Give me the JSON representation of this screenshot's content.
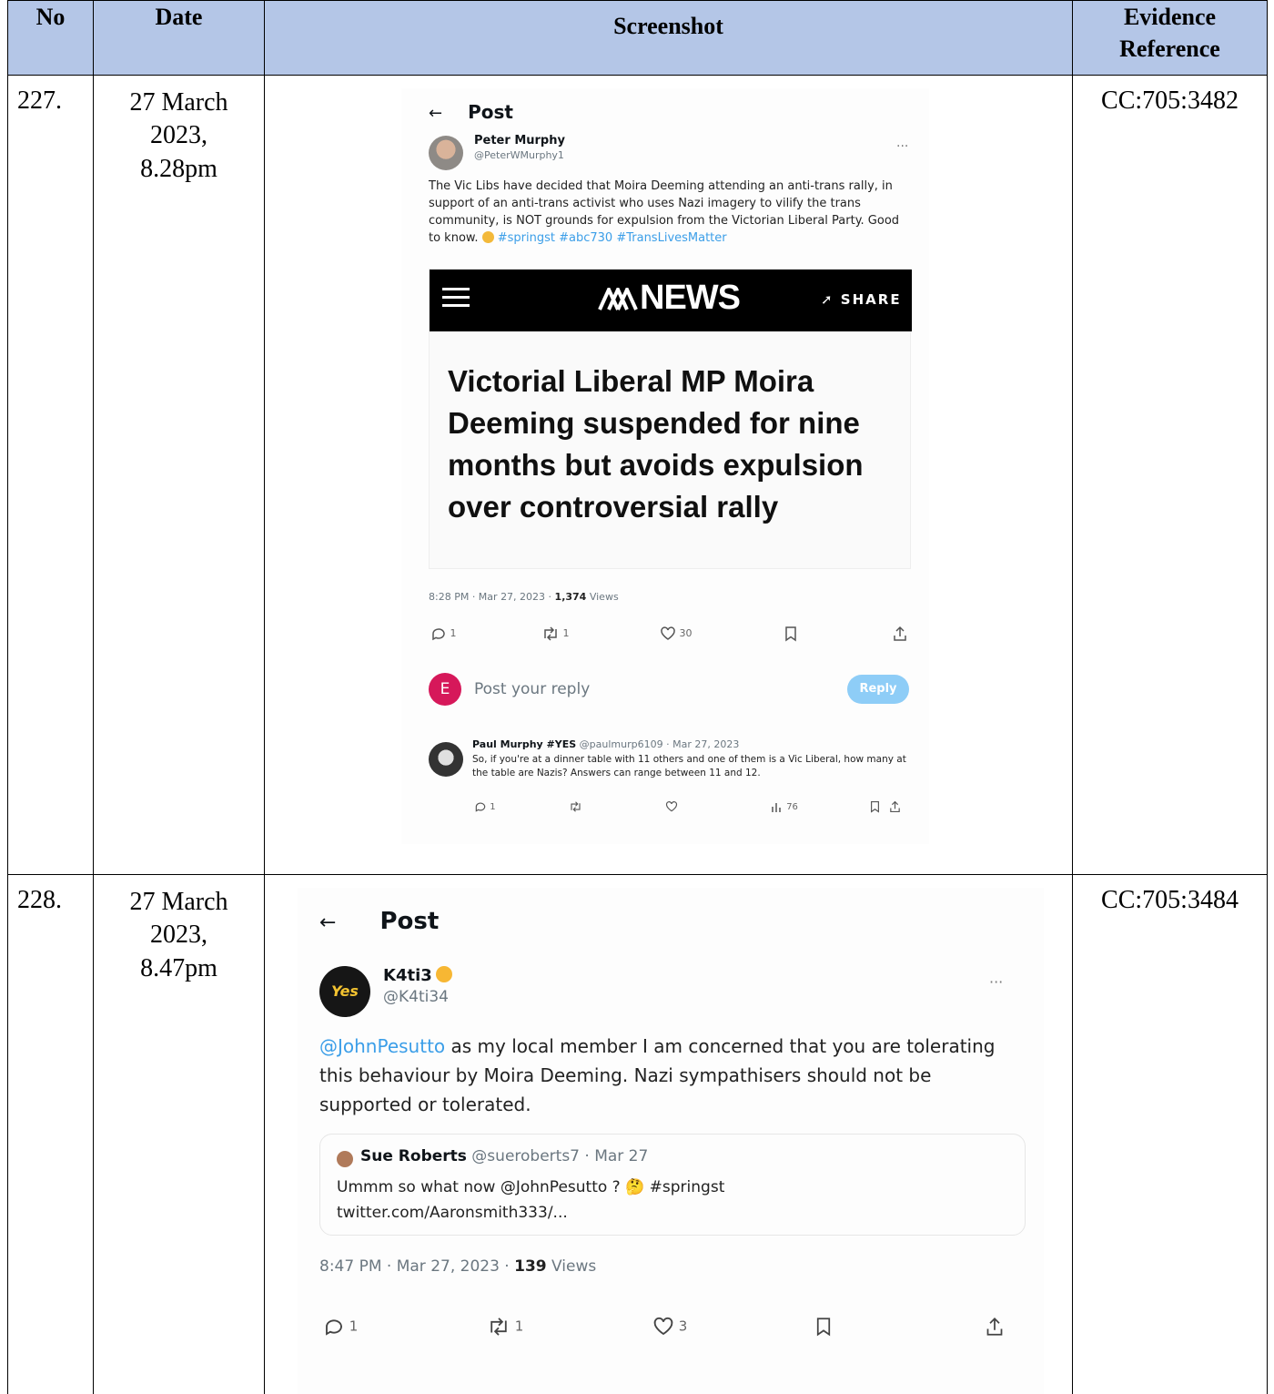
{
  "headers": {
    "no": "No",
    "date": "Date",
    "screenshot": "Screenshot",
    "evidence": "Evidence Reference"
  },
  "rows": [
    {
      "no": "227.",
      "date_line1": "27 March",
      "date_line2": "2023,",
      "date_line3": "8.28pm",
      "reference": "CC:705:3482",
      "tweet": {
        "topbar": "Post",
        "author_name": "Peter Murphy",
        "author_handle": "@PeterWMurphy1",
        "text": "The Vic Libs have decided that Moira Deeming attending an anti-trans rally, in support of an anti-trans activist who uses Nazi imagery to vilify the trans community, is NOT grounds for expulsion from the Victorian Liberal Party. Good to know.",
        "hashtags": "#springst #abc730 #TransLivesMatter",
        "card_logo": "NEWS",
        "card_share": "SHARE",
        "card_headline": "Victorial Liberal MP Moira Deeming suspended for nine months but avoids expulsion over controversial rally",
        "meta_time": "8:28 PM · Mar 27, 2023 · ",
        "meta_views_count": "1,374",
        "meta_views_label": " Views",
        "counts": {
          "replies": "1",
          "retweets": "1",
          "likes": "30"
        },
        "reply_avatar_letter": "E",
        "reply_placeholder": "Post your reply",
        "reply_button": "Reply",
        "reply": {
          "name": "Paul Murphy #YES",
          "handle_date": "@paulmurp6109 · Mar 27, 2023",
          "text": "So, if you're at a dinner table with 11 others and one of them is a Vic Liberal, how many at the table are Nazis? Answers can range between 11 and 12.",
          "counts": {
            "replies": "1",
            "retweets": "",
            "likes": "",
            "views": "76"
          }
        }
      }
    },
    {
      "no": "228.",
      "date_line1": "27 March",
      "date_line2": "2023,",
      "date_line3": "8.47pm",
      "reference": "CC:705:3484",
      "tweet": {
        "topbar": "Post",
        "avatar_text": "Yes",
        "author_name": "K4ti3",
        "author_handle": "@K4ti34",
        "mention": "@JohnPesutto",
        "text": " as my local member I am concerned that you are tolerating this behaviour by Moira Deeming. Nazi sympathisers should not be supported or tolerated.",
        "quote": {
          "name": "Sue Roberts",
          "handle_date": " @sueroberts7 · Mar 27",
          "line1": "Ummm so what now @JohnPesutto ? 🤔 #springst",
          "line2": "twitter.com/Aaronsmith333/..."
        },
        "meta_time": "8:47 PM · Mar 27, 2023 · ",
        "meta_views_count": "139",
        "meta_views_label": " Views",
        "counts": {
          "replies": "1",
          "retweets": "1",
          "likes": "3"
        }
      }
    }
  ]
}
